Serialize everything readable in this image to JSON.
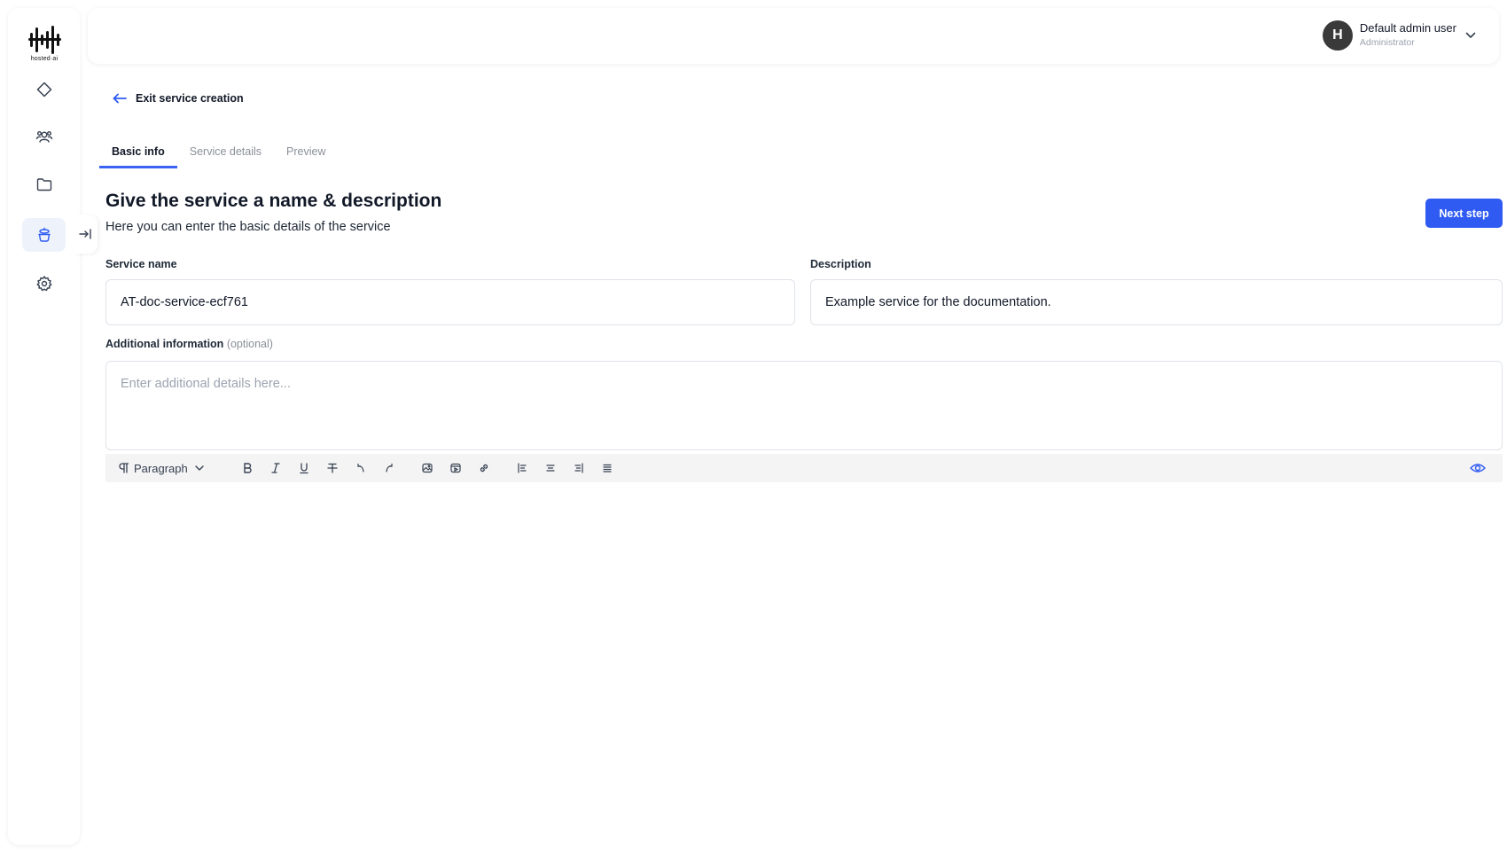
{
  "app": {
    "logo_text": "hosted·ai"
  },
  "sidebar": {
    "items": [
      {
        "name": "diamond-icon"
      },
      {
        "name": "users-icon"
      },
      {
        "name": "folder-icon"
      },
      {
        "name": "service-icon",
        "active": true
      },
      {
        "name": "gear-icon"
      }
    ]
  },
  "header": {
    "user": {
      "initial": "H",
      "name": "Default admin user",
      "role": "Administrator"
    }
  },
  "main": {
    "exit_label": "Exit service creation",
    "tabs": [
      {
        "label": "Basic info",
        "active": true
      },
      {
        "label": "Service details",
        "active": false
      },
      {
        "label": "Preview",
        "active": false
      }
    ],
    "title": "Give the service a name & description",
    "subtitle": "Here you can enter the basic details of the service",
    "next_label": "Next step",
    "form": {
      "service_name": {
        "label": "Service name",
        "value": "AT-doc-service-ecf761"
      },
      "description": {
        "label": "Description",
        "value": "Example service for the documentation."
      },
      "additional": {
        "label": "Additional information",
        "optional": "(optional)",
        "placeholder": "Enter additional details here..."
      }
    },
    "editor": {
      "block_type": "Paragraph"
    }
  },
  "colors": {
    "accent": "#2f5bf2",
    "tab_underline": "#3b63f3",
    "avatar_bg": "#3a3a3a"
  }
}
